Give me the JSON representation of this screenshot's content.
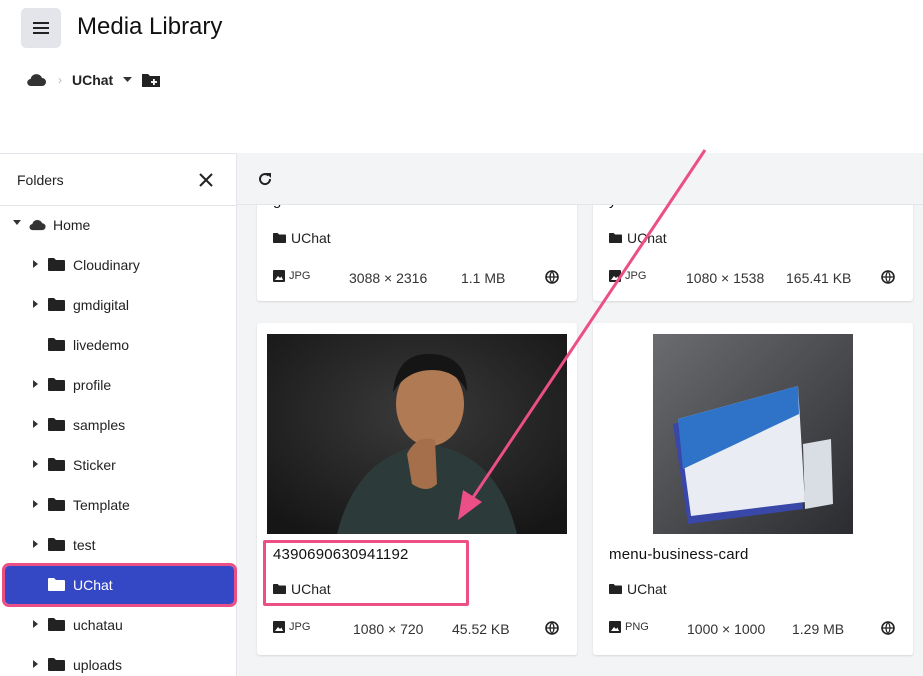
{
  "header": {
    "title": "Media Library",
    "menu_icon": "hamburger-icon"
  },
  "breadcrumb": {
    "root_icon": "cloud-icon",
    "separator": "›",
    "current": "UChat"
  },
  "sidebar": {
    "title": "Folders",
    "items": [
      {
        "label": "Home",
        "expanded": true
      },
      {
        "label": "Cloudinary"
      },
      {
        "label": "gmdigital"
      },
      {
        "label": "livedemo"
      },
      {
        "label": "profile"
      },
      {
        "label": "samples"
      },
      {
        "label": "Sticker"
      },
      {
        "label": "Template"
      },
      {
        "label": "test"
      },
      {
        "label": "UChat",
        "selected": true
      },
      {
        "label": "uchatau"
      },
      {
        "label": "uploads"
      }
    ]
  },
  "assets": [
    {
      "name": "g",
      "folder": "UChat",
      "format": "JPG",
      "dimensions": "3088 × 2316",
      "size": "1.1 MB"
    },
    {
      "name": "y",
      "folder": "UChat",
      "format": "JPG",
      "dimensions": "1080 × 1538",
      "size": "165.41 KB"
    },
    {
      "name": "4390690630941192",
      "folder": "UChat",
      "format": "JPG",
      "dimensions": "1080 × 720",
      "size": "45.52 KB"
    },
    {
      "name": "menu-business-card",
      "folder": "UChat",
      "format": "PNG",
      "dimensions": "1000 × 1000",
      "size": "1.29 MB"
    }
  ],
  "colors": {
    "accent": "#3448c5",
    "annotation": "#ec4e86",
    "panel_bg": "#f3f4f6"
  }
}
